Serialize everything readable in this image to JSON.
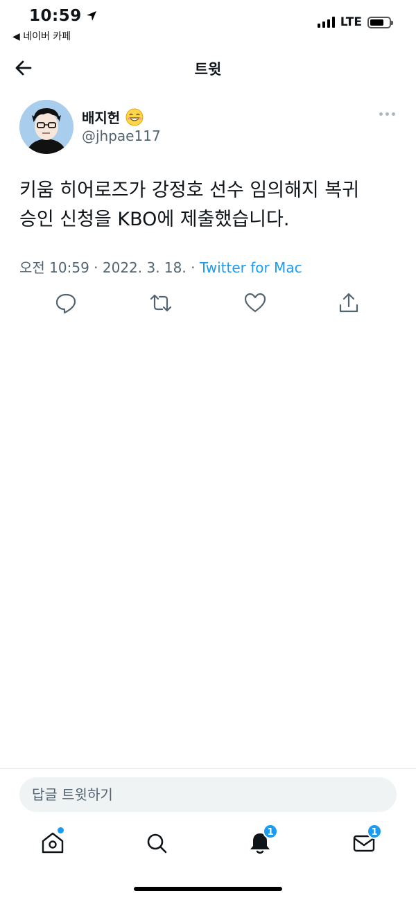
{
  "status_bar": {
    "time": "10:59",
    "back_app": "◀ 네이버 카페",
    "network": "LTE"
  },
  "header": {
    "title": "트윗"
  },
  "tweet": {
    "display_name": "배지헌",
    "emoji": "😁",
    "handle": "@jhpae117",
    "text_line1": "키움 히어로즈가 강정호 선수 임의해지 복귀",
    "text_line2": "승인 신청을 KBO에 제출했습니다.",
    "timestamp": "오전 10:59 · 2022. 3. 18. · ",
    "source": "Twitter for Mac"
  },
  "actions": {
    "icons": [
      "reply-icon",
      "retweet-icon",
      "like-icon",
      "share-icon"
    ]
  },
  "reply": {
    "placeholder": "답글 트윗하기"
  },
  "tabbar": {
    "notifications_badge": "1",
    "messages_badge": "1"
  },
  "colors": {
    "accent": "#1d9bf0",
    "secondary_text": "#536471"
  }
}
